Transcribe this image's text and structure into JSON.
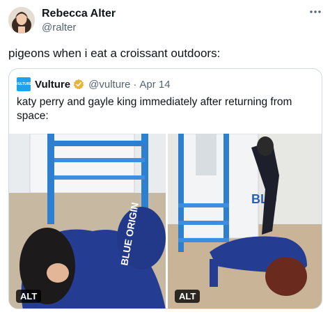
{
  "tweet": {
    "author_name": "Rebecca Alter",
    "author_handle": "@ralter",
    "text": "pigeons when i eat a croissant outdoors:"
  },
  "quoted": {
    "logo_text": "VULTURE",
    "author_name": "Vulture",
    "author_handle": "@vulture",
    "separator": "·",
    "date": "Apr 14",
    "text": "katy perry and gayle king immediately after returning from space:",
    "images": [
      {
        "alt_label": "ALT",
        "suit_text": "BLUE ORIGIN"
      },
      {
        "alt_label": "ALT",
        "capsule_text": "BLU"
      }
    ]
  },
  "icons": [
    "avatar",
    "more-icon",
    "verified-badge-icon",
    "vulture-logo"
  ],
  "colors": {
    "verified": "#e8b339",
    "logo": "#1da1f2",
    "stairs": "#2f7fd0",
    "suit": "#223b8f"
  }
}
